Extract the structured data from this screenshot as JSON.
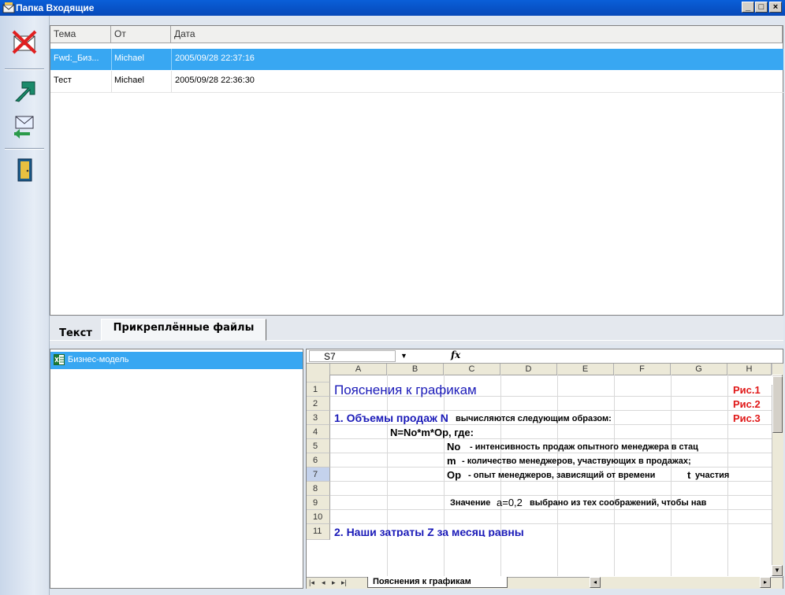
{
  "window": {
    "title": "Папка Входящие",
    "buttons": {
      "minimize": "_",
      "maximize": "□",
      "close": "×"
    }
  },
  "toolbar": [
    {
      "icon": "delete-mail-icon"
    },
    {
      "icon": "forward-arrow-icon"
    },
    {
      "icon": "send-receive-mail-icon"
    },
    {
      "icon": "exit-door-icon"
    }
  ],
  "columns": [
    "Тема",
    "От",
    "Дата"
  ],
  "messages": [
    {
      "subject": "Fwd:_Биз...",
      "from": "Michael",
      "date": "2005/09/28 22:37:16",
      "selected": true
    },
    {
      "subject": "Тест",
      "from": "Michael",
      "date": "2005/09/28 22:36:30",
      "selected": false
    }
  ],
  "tabs": {
    "text": "Текст",
    "attachments": "Прикреплённые файлы",
    "active": "attachments"
  },
  "attachments": [
    {
      "name": "Бизнес-модель",
      "icon": "excel-file-icon"
    }
  ],
  "spreadsheet": {
    "name_box": "S7",
    "fx": "fx",
    "columns": [
      "A",
      "B",
      "C",
      "D",
      "E",
      "F",
      "G",
      "H"
    ],
    "rows": [
      "1",
      "2",
      "3",
      "4",
      "5",
      "6",
      "7",
      "8",
      "9",
      "10",
      "11"
    ],
    "selected_row": "7",
    "cells": {
      "r1_title": "Пояснения к графикам",
      "r1_h": "Рис.1",
      "r2_h": "Рис.2",
      "r3_heading": "1. Объемы продаж N",
      "r3_rest": "вычисляются следующим образом:",
      "r3_h": "Рис.3",
      "r4_formula": "N=No*m*Op, где:",
      "r5_var": "No",
      "r5_desc": "- интенсивность продаж опытного менеджера в стац",
      "r6_var": "m",
      "r6_desc": "- количество менеджеров, участвующих в продажах;",
      "r7_var": "Op",
      "r7_desc": "- опыт менеджеров, зависящий от времени",
      "r7_t": "t",
      "r7_rest": "участия",
      "r9_prefix": "Значение",
      "r9_value": "a=0,2",
      "r9_rest": "выбрано из тех соображений, чтобы нав",
      "r11_heading": "2. Наши затраты Z за  месяц равны"
    },
    "sheet_tab": "Пояснения к графикам"
  }
}
